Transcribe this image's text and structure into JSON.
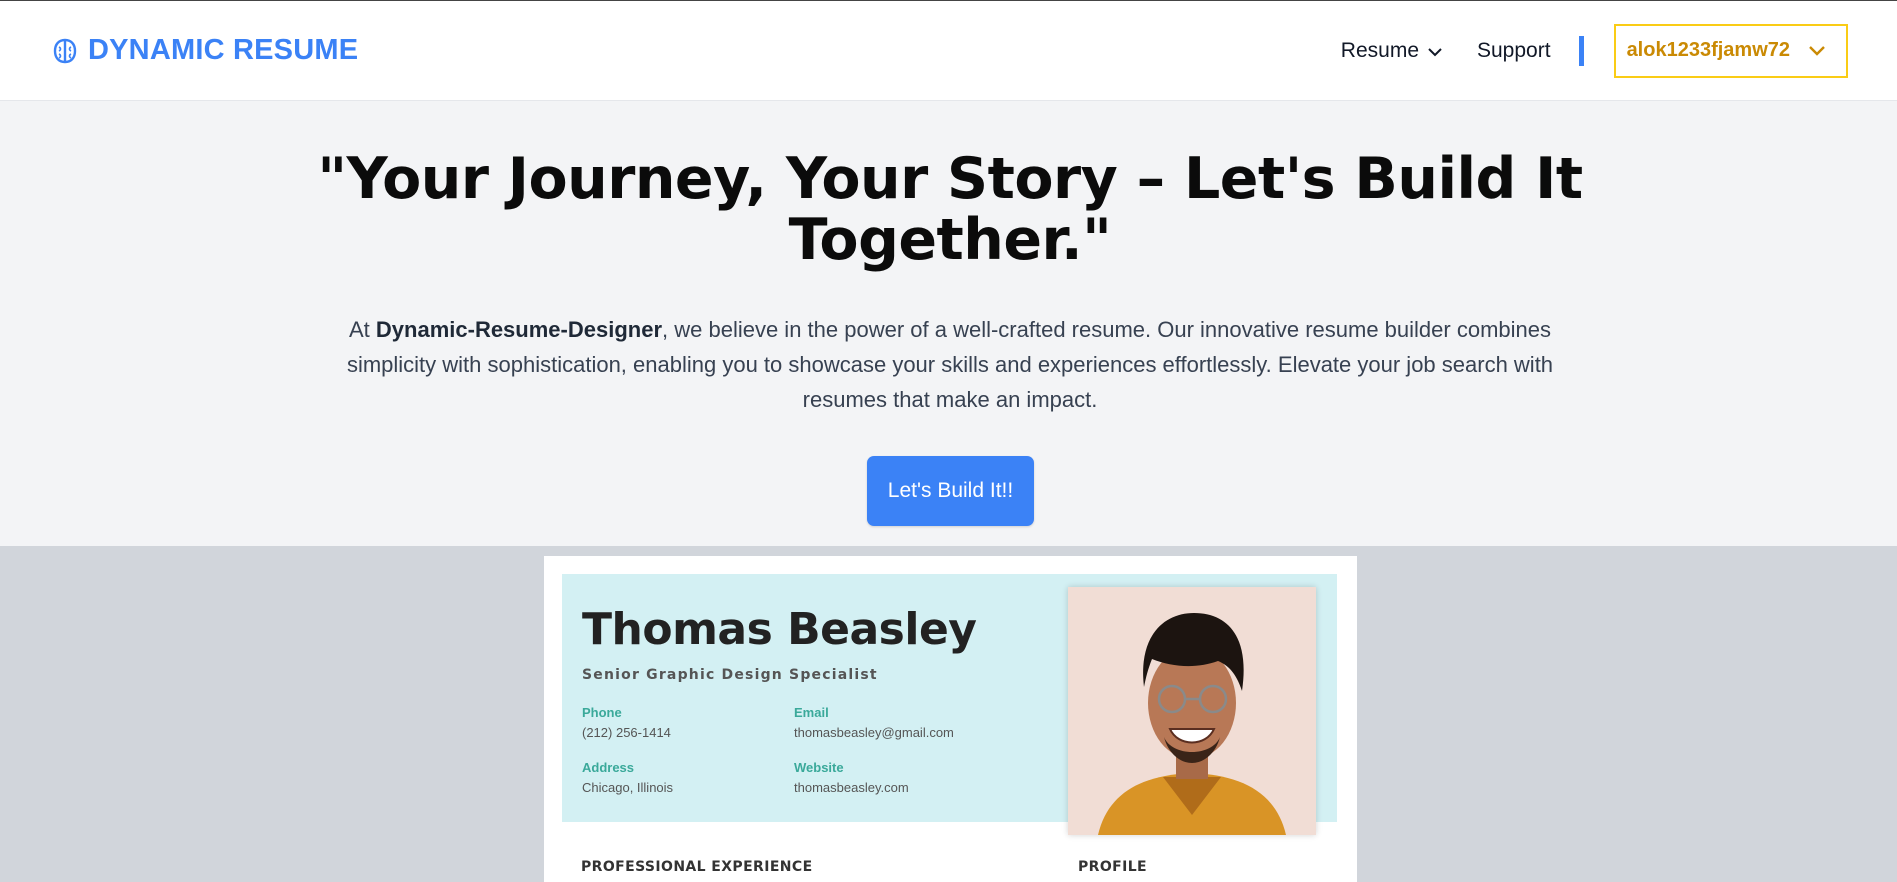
{
  "navbar": {
    "brand": "DYNAMIC RESUME",
    "menu_resume": "Resume",
    "menu_support": "Support",
    "user_label": "alok1233fjamw72"
  },
  "hero": {
    "headline": "\"Your Journey, Your Story – Let's Build It Together.\"",
    "lead_prefix": "At ",
    "lead_brand": "Dynamic-Resume-Designer",
    "lead_suffix": ", we believe in the power of a well-crafted resume. Our innovative resume builder combines simplicity with sophistication, enabling you to showcase your skills and experiences effortlessly. Elevate your job search with resumes that make an impact.",
    "cta_label": "Let's Build It!!"
  },
  "resume_preview": {
    "name": "Thomas Beasley",
    "role": "Senior Graphic Design Specialist",
    "phone_label": "Phone",
    "phone": "(212) 256-1414",
    "email_label": "Email",
    "email": "thomasbeasley@gmail.com",
    "address_label": "Address",
    "address": "Chicago, Illinois",
    "website_label": "Website",
    "website": "thomasbeasley.com",
    "section_experience": "PROFESSIONAL EXPERIENCE",
    "section_profile": "PROFILE"
  },
  "colors": {
    "brand": "#3b82f6",
    "user_accent": "#ca8a04",
    "user_border": "#facc15",
    "resume_header_bg": "#d3f0f3",
    "resume_label": "#3aa99a"
  },
  "icons": {
    "brand": "brain-icon",
    "menu_chevron": "chevron-down-icon",
    "user_chevron": "chevron-down-icon"
  }
}
